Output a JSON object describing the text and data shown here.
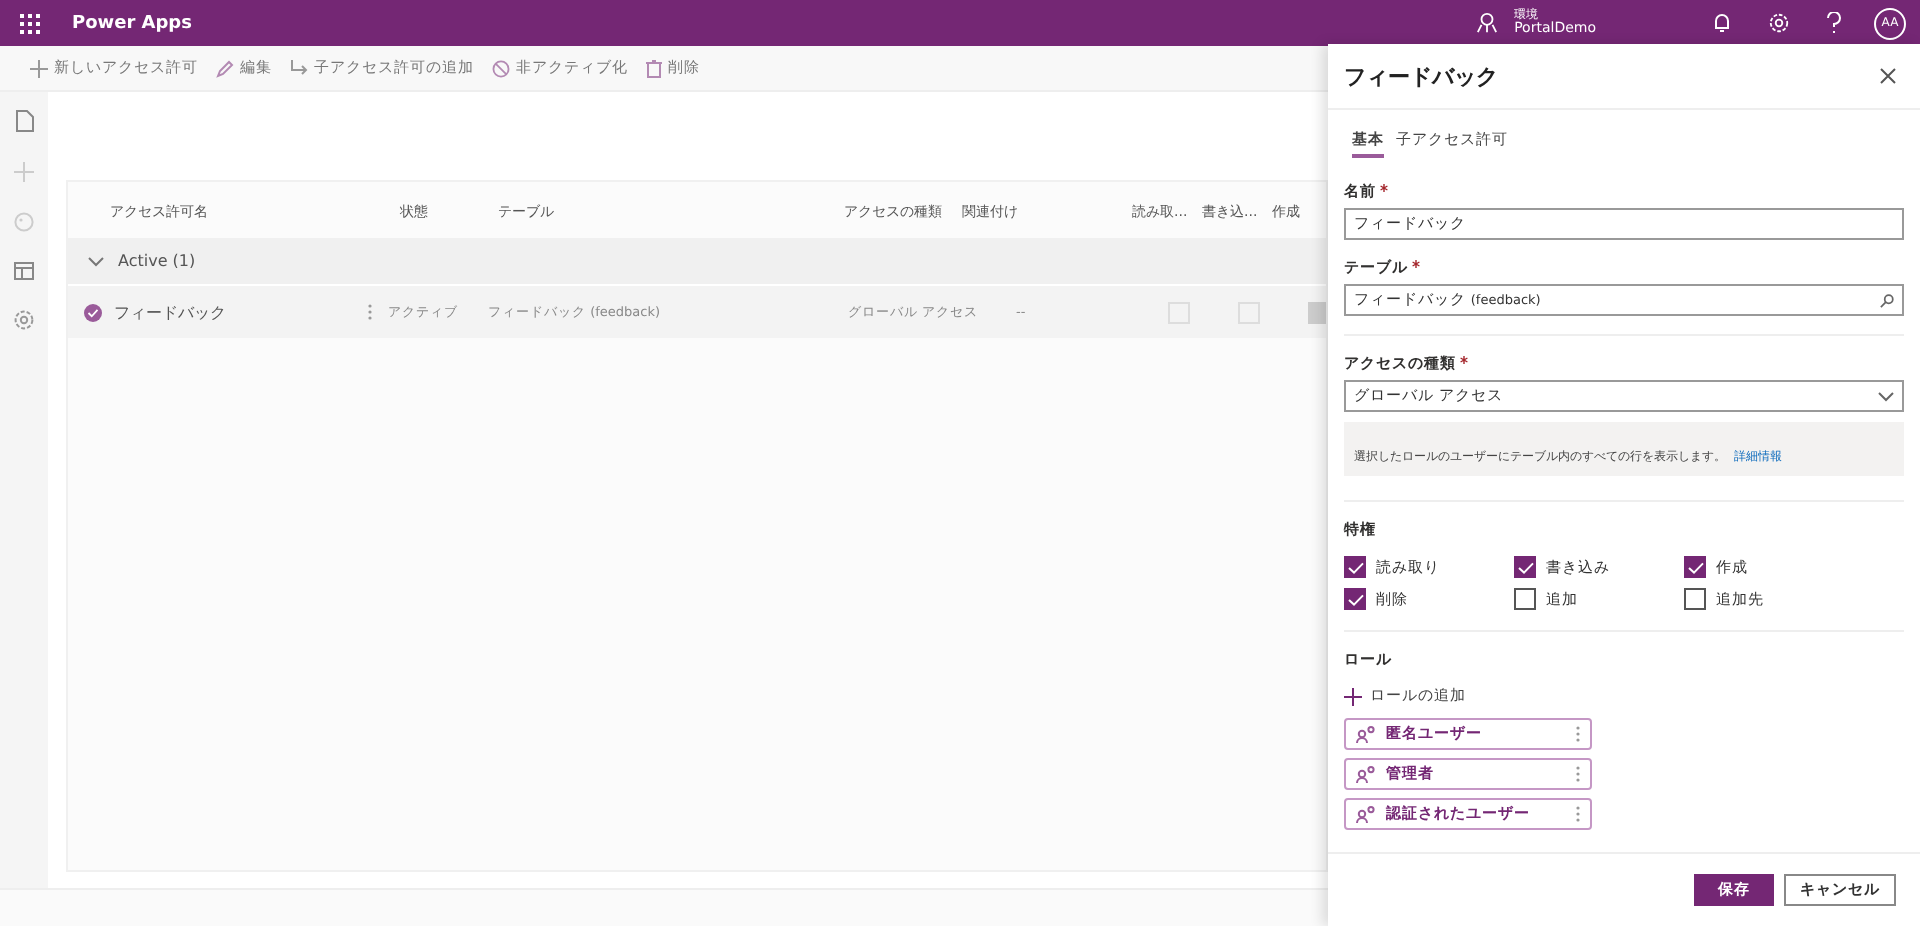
{
  "header": {
    "app_name": "Power Apps",
    "environment_label": "環境",
    "environment_name": "PortalDemo",
    "avatar": "AA"
  },
  "command_bar": [
    {
      "kind": "plus",
      "label": "新しいアクセス許可"
    },
    {
      "kind": "edit",
      "label": "編集"
    },
    {
      "kind": "child",
      "label": "子アクセス許可の追加"
    },
    {
      "kind": "block",
      "label": "非アクティブ化"
    },
    {
      "kind": "delete",
      "label": "削除"
    }
  ],
  "table": {
    "columns": [
      "アクセス許可名",
      "状態",
      "テーブル",
      "アクセスの種類",
      "関連付け",
      "読み取...",
      "書き込...",
      "作成"
    ],
    "group": {
      "label": "Active (1)",
      "expanded": true
    },
    "rows": [
      {
        "name": "フィードバック",
        "status": "アクティブ",
        "table": "フィードバック (feedback)",
        "access": "グローバル アクセス",
        "relation": "--",
        "read": false,
        "write": false,
        "create": true
      }
    ]
  },
  "panel": {
    "title": "フィードバック",
    "tabs": [
      {
        "label": "基本",
        "selected": true
      },
      {
        "label": "子アクセス許可",
        "selected": false
      }
    ],
    "name_label": "名前",
    "name_value": "フィードバック",
    "table_label": "テーブル",
    "table_value": "フィードバック",
    "table_value_suffix": "(feedback)",
    "access_label": "アクセスの種類",
    "access_value": "グローバル アクセス",
    "info_text": "選択したロールのユーザーにテーブル内のすべての行を表示します。",
    "info_link": "詳細情報",
    "privileges_label": "特権",
    "privileges": [
      {
        "label": "読み取り",
        "checked": true
      },
      {
        "label": "書き込み",
        "checked": true
      },
      {
        "label": "作成",
        "checked": true
      },
      {
        "label": "削除",
        "checked": true
      },
      {
        "label": "追加",
        "checked": false
      },
      {
        "label": "追加先",
        "checked": false
      }
    ],
    "roles_label": "ロール",
    "add_role": "ロールの追加",
    "roles": [
      "匿名ユーザー",
      "管理者",
      "認証されたユーザー"
    ],
    "save": "保存",
    "cancel": "キャンセル"
  }
}
